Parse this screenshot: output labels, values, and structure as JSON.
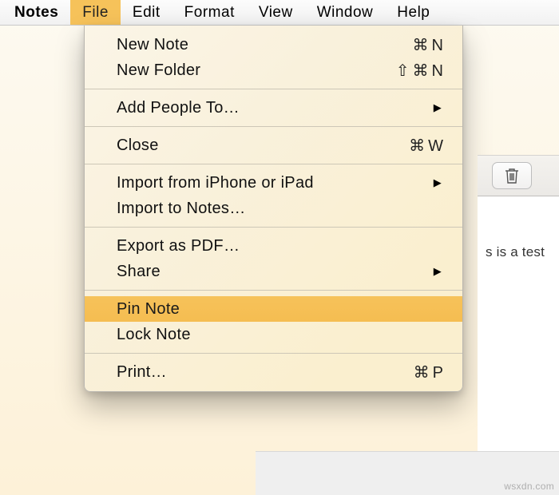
{
  "menubar": {
    "appname": "Notes",
    "items": [
      "File",
      "Edit",
      "Format",
      "View",
      "Window",
      "Help"
    ]
  },
  "file_menu": {
    "new_note": {
      "label": "New Note",
      "shortcut": "⌘N"
    },
    "new_folder": {
      "label": "New Folder",
      "shortcut": "⇧⌘N"
    },
    "add_people": {
      "label": "Add People To…"
    },
    "close": {
      "label": "Close",
      "shortcut": "⌘W"
    },
    "import_iphone": {
      "label": "Import from iPhone or iPad"
    },
    "import_notes": {
      "label": "Import to Notes…"
    },
    "export_pdf": {
      "label": "Export as PDF…"
    },
    "share": {
      "label": "Share"
    },
    "pin_note": {
      "label": "Pin Note"
    },
    "lock_note": {
      "label": "Lock Note"
    },
    "print": {
      "label": "Print…",
      "shortcut": "⌘P"
    }
  },
  "content": {
    "visible_text": "s is a test"
  },
  "watermark": "wsxdn.com",
  "colors": {
    "highlight": "#f6c25a",
    "menubar_bg": "#f1f1f1",
    "dropdown_bg": "#f9f1dc"
  }
}
